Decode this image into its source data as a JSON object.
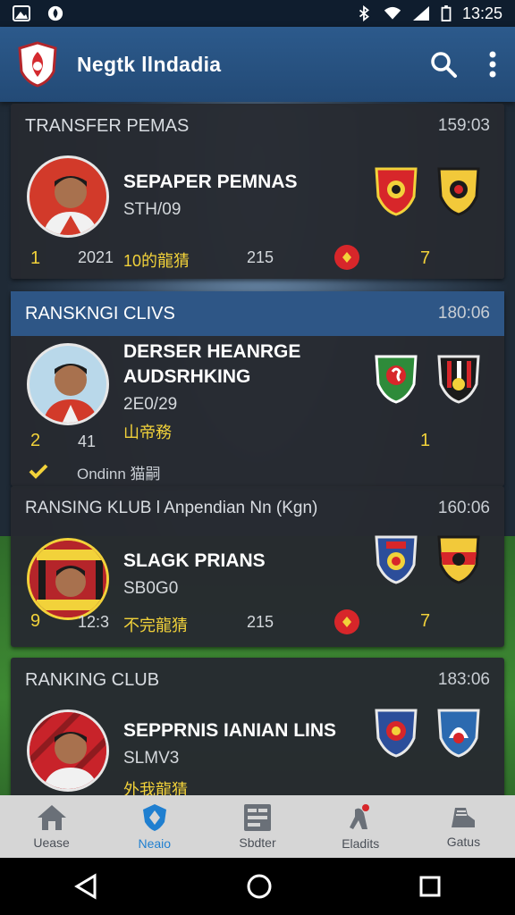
{
  "status_bar": {
    "time": "13:25"
  },
  "app": {
    "title": "Negtk llndadia"
  },
  "cards": [
    {
      "header": "TRANSFER PEMAS",
      "time": "159:03",
      "name": "SEPAPER PEMNAS",
      "sub": "STH/09",
      "left_num": "1",
      "year": "2021",
      "tag": "10的龍猜",
      "mid_num": "215",
      "right_num": "7"
    },
    {
      "header": "RANSKNGI CLIVS",
      "time": "180:06",
      "name": "DERSER HEANRGE",
      "name2": "AUDSRHKING",
      "sub": "2E0/29",
      "tag": "山帝務",
      "left_num": "2",
      "year": "41",
      "right_num": "1",
      "footer": "Ondinn 猫嗣"
    },
    {
      "header": "RANSING KLUB l Anpendian Nn (Kgn)",
      "time": "160:06",
      "name": "SLAGK PRIANS",
      "sub": "SB0G0",
      "left_num": "9",
      "year": "12:3",
      "tag": "不完龍猜",
      "mid_num": "215",
      "right_num": "7"
    },
    {
      "header": "RANKING CLUB",
      "time": "183:06",
      "name": "SEPPRNIS IANIAN LINS",
      "sub": "SLMV3",
      "tag": "外我龍猜"
    }
  ],
  "nav": [
    {
      "label": "Uease",
      "icon": "home-icon"
    },
    {
      "label": "Neaio",
      "icon": "shield-icon"
    },
    {
      "label": "Sbdter",
      "icon": "grid-icon"
    },
    {
      "label": "Eladits",
      "icon": "player-icon"
    },
    {
      "label": "Gatus",
      "icon": "boot-icon"
    }
  ],
  "colors": {
    "app_bar": "#2c5a8c",
    "accent_yellow": "#f2d23a",
    "badge_red": "#d7262a",
    "nav_active": "#1f7fd0"
  }
}
